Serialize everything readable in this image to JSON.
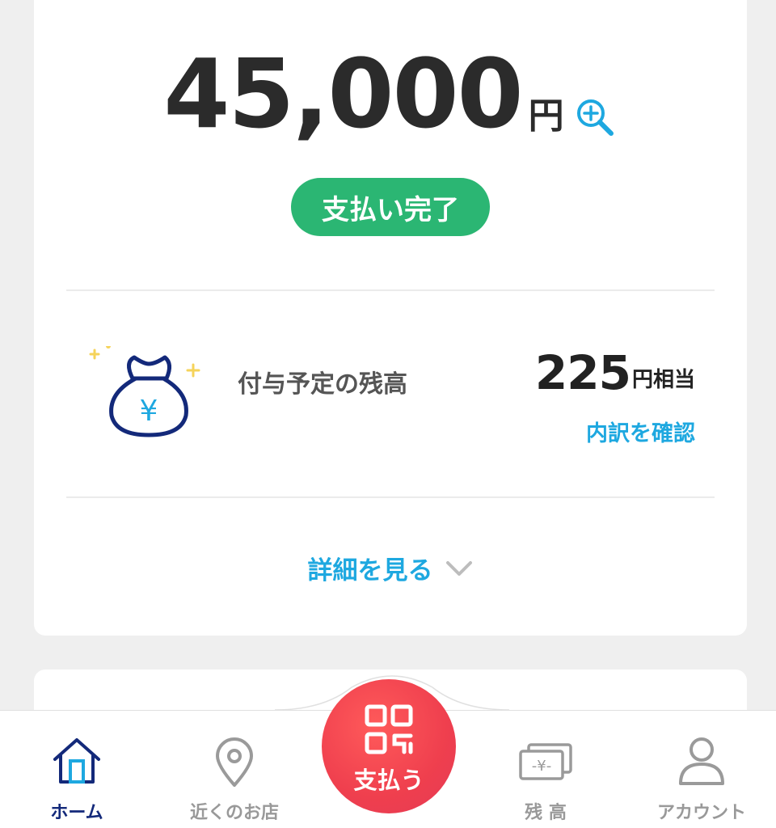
{
  "payment": {
    "amount": "45,000",
    "currency": "円",
    "status": "支払い完了"
  },
  "points": {
    "label": "付与予定の残高",
    "value": "225",
    "suffix": "円相当",
    "link": "内訳を確認"
  },
  "details": {
    "label": "詳細を見る"
  },
  "nav": {
    "home": "ホーム",
    "stores": "近くのお店",
    "pay": "支払う",
    "balance": "残 高",
    "account": "アカウント"
  },
  "colors": {
    "status_green": "#2bb673",
    "link_blue": "#1ea8e0",
    "pay_red": "#ef3f4e",
    "active_nav": "#13297a"
  }
}
